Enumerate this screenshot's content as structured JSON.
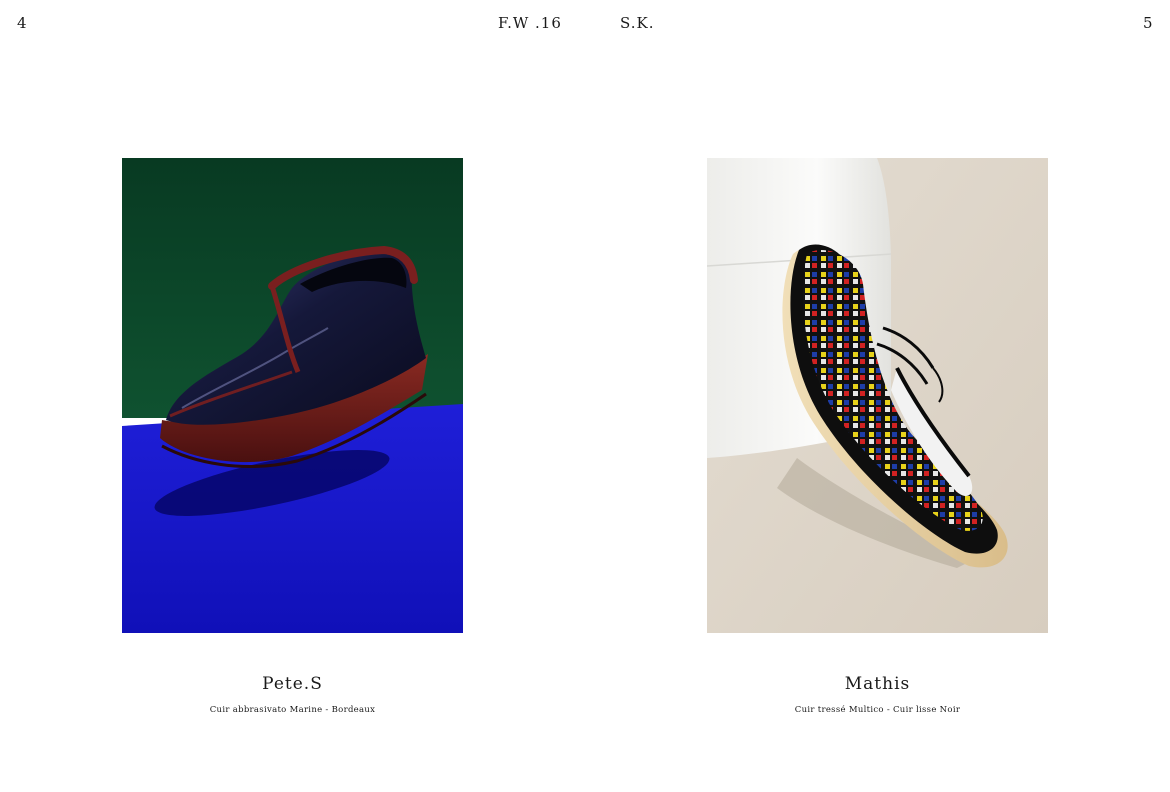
{
  "header": {
    "page_left": "4",
    "season": "F.W .16",
    "brand": "S.K.",
    "page_right": "5"
  },
  "products": [
    {
      "name": "Pete.S",
      "description": "Cuir abbrasivato Marine - Bordeaux",
      "image_icon": "loafer-shoe-photo",
      "colors": {
        "background_top": "#0b4226",
        "background_floor": "#1414c4",
        "shoe": "#1a1d45",
        "trim": "#7a1f1f"
      }
    },
    {
      "name": "Mathis",
      "description": "Cuir tressé Multico - Cuir lisse Noir",
      "image_icon": "derby-shoe-photo",
      "colors": {
        "background": "#ddd4c7",
        "pedestal": "#f4f4f2",
        "shoe": "#151515",
        "sole": "#e9d3a8"
      }
    }
  ]
}
